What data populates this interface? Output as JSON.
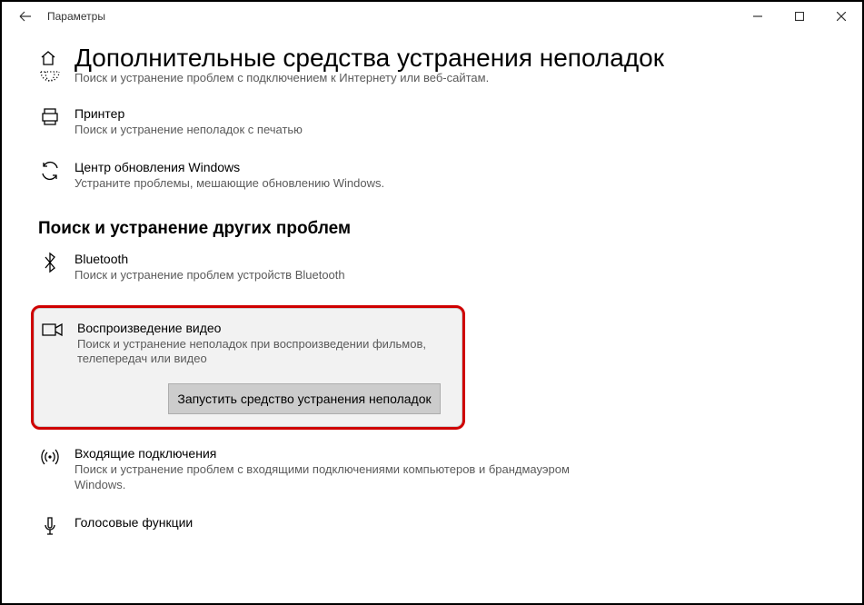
{
  "window": {
    "title": "Параметры"
  },
  "page": {
    "heading": "Дополнительные средства устранения неполадок",
    "internet_desc": "Поиск и устранение проблем с подключением к Интернету или веб-сайтам."
  },
  "items": {
    "printer": {
      "title": "Принтер",
      "desc": "Поиск и устранение неполадок с печатью"
    },
    "update": {
      "title": "Центр обновления Windows",
      "desc": "Устраните проблемы, мешающие обновлению Windows."
    },
    "bluetooth": {
      "title": "Bluetooth",
      "desc": "Поиск и устранение проблем устройств Bluetooth"
    },
    "video": {
      "title": "Воспроизведение видео",
      "desc": "Поиск и устранение неполадок при воспроизведении фильмов, телепередач или видео",
      "button": "Запустить средство устранения неполадок"
    },
    "incoming": {
      "title": "Входящие подключения",
      "desc": "Поиск и устранение проблем с входящими подключениями компьютеров и брандмауэром Windows."
    },
    "voice": {
      "title": "Голосовые функции"
    }
  },
  "section_other": "Поиск и устранение других проблем"
}
